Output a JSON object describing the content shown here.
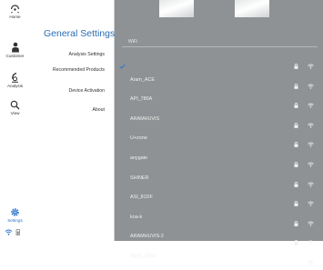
{
  "rail": {
    "items": [
      {
        "label": "Home",
        "icon": "home-icon"
      },
      {
        "label": "Customer",
        "icon": "customer-icon"
      },
      {
        "label": "Analysis",
        "icon": "analysis-icon"
      },
      {
        "label": "View",
        "icon": "view-icon"
      },
      {
        "label": "Settings",
        "icon": "settings-icon",
        "active": true
      }
    ],
    "accent": "#2b73c9"
  },
  "menu": {
    "title": "General Settings",
    "items": [
      {
        "label": "Analysis Settings"
      },
      {
        "label": "Recommended Products"
      },
      {
        "label": "Device Activation"
      },
      {
        "label": "About"
      }
    ]
  },
  "wifi": {
    "header": "WiFi",
    "networks": [
      {
        "name": "",
        "connected": true,
        "secured": true
      },
      {
        "name": "Aram_ACE",
        "secured": true
      },
      {
        "name": "API_780A",
        "secured": true
      },
      {
        "name": "ARAMHUVIS",
        "secured": true
      },
      {
        "name": "U+zone",
        "secured": true
      },
      {
        "name": "anygate",
        "secured": true
      },
      {
        "name": "SHINER",
        "secured": true
      },
      {
        "name": "ASI_81DF",
        "secured": true
      },
      {
        "name": "koa-k",
        "secured": true
      },
      {
        "name": "ARAMHUVIS-2",
        "secured": true
      },
      {
        "name": "ABW_7A5F",
        "secured": false
      }
    ]
  }
}
